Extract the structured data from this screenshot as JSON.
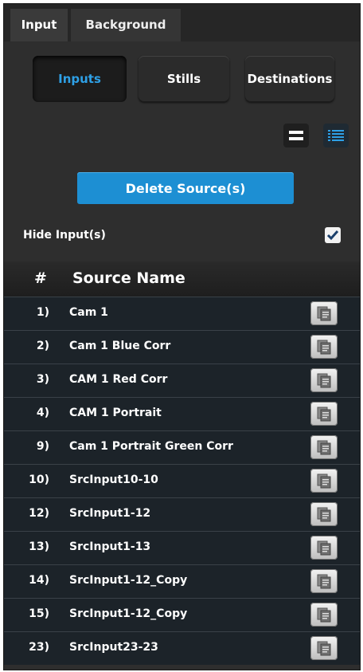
{
  "tabs": [
    {
      "label": "Input",
      "active": true
    },
    {
      "label": "Background",
      "active": false
    }
  ],
  "source_types": [
    {
      "label": "Inputs",
      "selected": true
    },
    {
      "label": "Stills",
      "selected": false
    },
    {
      "label": "Destinations",
      "selected": false
    }
  ],
  "view_toggles": {
    "compact_icon": "compact-view-icon",
    "list_icon": "list-view-icon",
    "active": "list"
  },
  "delete_button": {
    "label": "Delete Source(s)"
  },
  "hide_inputs": {
    "label": "Hide Input(s)",
    "checked": true
  },
  "table": {
    "headers": {
      "num": "#",
      "name": "Source Name"
    },
    "rows": [
      {
        "num": "1)",
        "name": "Cam 1"
      },
      {
        "num": "2)",
        "name": "Cam 1 Blue Corr"
      },
      {
        "num": "3)",
        "name": "CAM 1 Red Corr"
      },
      {
        "num": "4)",
        "name": "CAM 1 Portrait"
      },
      {
        "num": "9)",
        "name": "Cam 1 Portrait Green Corr"
      },
      {
        "num": "10)",
        "name": "SrcInput10-10"
      },
      {
        "num": "12)",
        "name": "SrcInput1-12"
      },
      {
        "num": "13)",
        "name": "SrcInput1-13"
      },
      {
        "num": "14)",
        "name": "SrcInput1-12_Copy"
      },
      {
        "num": "15)",
        "name": "SrcInput1-12_Copy"
      },
      {
        "num": "23)",
        "name": "SrcInput23-23"
      }
    ],
    "row_action_icon": "copy-icon"
  },
  "colors": {
    "accent": "#1d8fd3",
    "selected_text": "#2ea0e6",
    "row_bg": "#1c2329"
  }
}
